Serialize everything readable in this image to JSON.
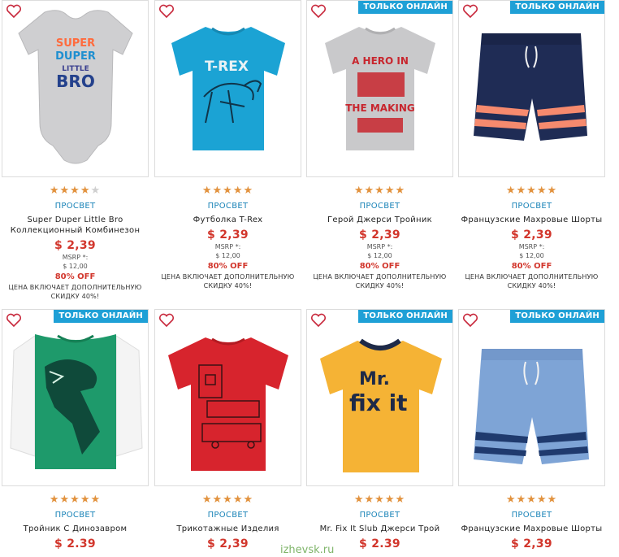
{
  "colors": {
    "accent": "#1fa0d6",
    "price": "#d2362c",
    "star": "#e2923e",
    "brand": "#1b84b8"
  },
  "products": [
    {
      "badge": "",
      "rating": 4,
      "brand": "ПРОСВЕТ",
      "name": "Super Duper Little Bro Коллекционный Комбинезон",
      "price": "$ 2,39",
      "msrp_label": "MSRP *:",
      "msrp": "$ 12,00",
      "discount": "80% OFF",
      "note": "ЦЕНА ВКЛЮЧАЕТ ДОПОЛНИТЕЛЬНУЮ СКИДКУ 40%!",
      "print_lines": [
        "SUPER",
        "DUPER",
        "LITTLE",
        "BRO"
      ]
    },
    {
      "badge": "",
      "rating": 5,
      "brand": "ПРОСВЕТ",
      "name": "Футболка T-Rex",
      "price": "$ 2,39",
      "msrp_label": "MSRP *:",
      "msrp": "$ 12,00",
      "discount": "80% OFF",
      "note": "ЦЕНА ВКЛЮЧАЕТ ДОПОЛНИТЕЛЬНУЮ СКИДКУ 40%!",
      "print_lines": [
        "T-REX"
      ]
    },
    {
      "badge": "ТОЛЬКО ОНЛАЙН",
      "rating": 5,
      "brand": "ПРОСВЕТ",
      "name": "Герой Джерси Тройник",
      "price": "$ 2,39",
      "msrp_label": "MSRP *:",
      "msrp": "$ 12,00",
      "discount": "80% OFF",
      "note": "ЦЕНА ВКЛЮЧАЕТ ДОПОЛНИТЕЛЬНУЮ СКИДКУ 40%!",
      "print_lines": [
        "A HERO IN",
        "THE MAKING"
      ]
    },
    {
      "badge": "ТОЛЬКО ОНЛАЙН",
      "rating": 5,
      "brand": "ПРОСВЕТ",
      "name": "Французские Махровые Шорты",
      "price": "$ 2,39",
      "msrp_label": "MSRP *:",
      "msrp": "$ 12,00",
      "discount": "80% OFF",
      "note": "ЦЕНА ВКЛЮЧАЕТ ДОПОЛНИТЕЛЬНУЮ СКИДКУ 40%!",
      "print_lines": []
    },
    {
      "badge": "ТОЛЬКО ОНЛАЙН",
      "rating": 5,
      "brand": "ПРОСВЕТ",
      "name": "Тройник С Динозавром",
      "price": "$ 2.39",
      "msrp_label": "",
      "msrp": "",
      "discount": "",
      "note": "",
      "print_lines": []
    },
    {
      "badge": "",
      "rating": 5,
      "brand": "ПРОСВЕТ",
      "name": "Трикотажные Изделия",
      "price": "$ 2,39",
      "msrp_label": "",
      "msrp": "",
      "discount": "",
      "note": "",
      "print_lines": []
    },
    {
      "badge": "ТОЛЬКО ОНЛАЙН",
      "rating": 5,
      "brand": "ПРОСВЕТ",
      "name": "Mr. Fix It Slub Джерси Трой",
      "price": "$ 2.39",
      "msrp_label": "",
      "msrp": "",
      "discount": "",
      "note": "",
      "print_lines": [
        "Mr.",
        "fix it"
      ]
    },
    {
      "badge": "ТОЛЬКО ОНЛАЙН",
      "rating": 5,
      "brand": "ПРОСВЕТ",
      "name": "Французские Махровые Шорты",
      "price": "$ 2,39",
      "msrp_label": "",
      "msrp": "",
      "discount": "",
      "note": "",
      "print_lines": []
    }
  ],
  "watermark": "izhevsk.ru"
}
